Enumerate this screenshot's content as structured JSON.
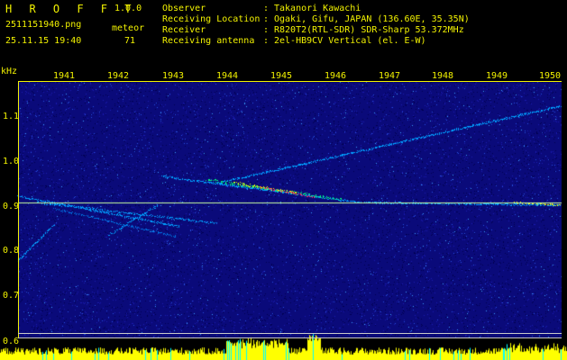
{
  "header": {
    "app_name": "H R O F F T",
    "version": "1.0.0",
    "filename": "2511151940.png",
    "datetime": "25.11.15 19:40",
    "meteor_label": "meteor",
    "meteor_count": "71",
    "info": [
      {
        "label": "Observer",
        "sep": ":",
        "value": "Takanori Kawachi"
      },
      {
        "label": "Receiving Location",
        "sep": ":",
        "value": "Ogaki, Gifu, JAPAN (136.60E, 35.35N)"
      },
      {
        "label": "Receiver",
        "sep": ":",
        "value": "R820T2(RTL-SDR) SDR-Sharp 53.372MHz"
      },
      {
        "label": "Receiving antenna",
        "sep": ":",
        "value": "2el-HB9CV Vertical (el. E-W)"
      }
    ]
  },
  "axis": {
    "y_unit": "kHz",
    "y_ticks": [
      "1.1",
      "1.0",
      "0.9",
      "0.8",
      "0.7",
      "0.6"
    ],
    "x_ticks": [
      "1941",
      "1942",
      "1943",
      "1944",
      "1945",
      "1946",
      "1947",
      "1948",
      "1949",
      "1950"
    ]
  },
  "chart_data": {
    "type": "heatmap",
    "xlabel": "",
    "ylabel": "kHz",
    "x_ticks": [
      "1941",
      "1942",
      "1943",
      "1944",
      "1945",
      "1946",
      "1947",
      "1948",
      "1949",
      "1950"
    ],
    "y_ticks": [
      1.1,
      1.0,
      0.9,
      0.8,
      0.7,
      0.6
    ],
    "ylim": [
      0.57,
      1.19
    ],
    "colors": {
      "background_noise": "#0a0a7a",
      "signal_low": "#00a0ff",
      "signal_mid": "#00ff80",
      "signal_high": "#ffff00",
      "signal_peak": "#ff2060",
      "axes": "#f2f200",
      "bottom_bars": "#ffff00",
      "bottom_bars_alt": "#00ffff"
    }
  }
}
